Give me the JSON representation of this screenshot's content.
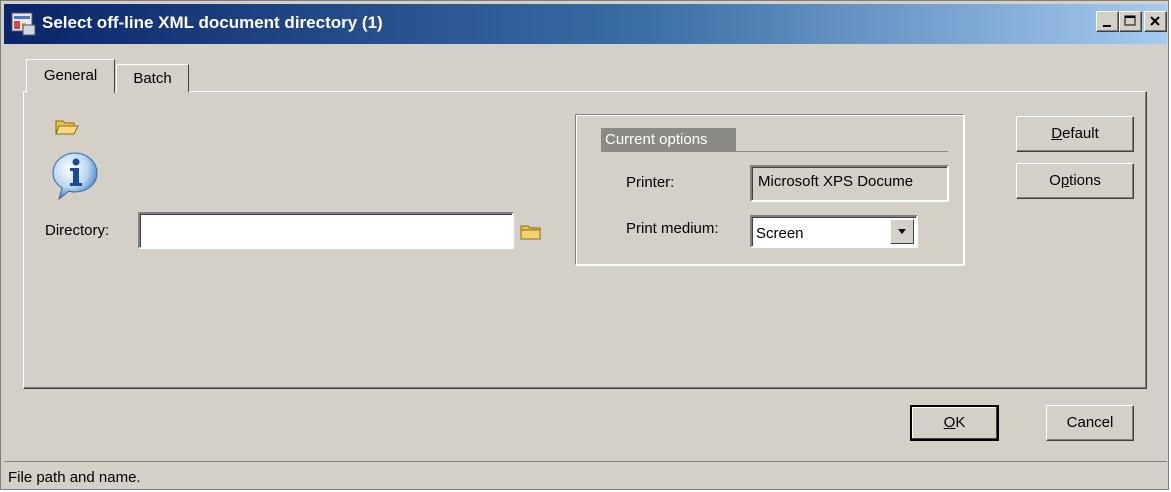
{
  "window": {
    "title": "Select off-line XML document directory (1)",
    "controls": [
      "minimize",
      "maximize",
      "close"
    ]
  },
  "tabs": [
    {
      "label": "General",
      "active": true
    },
    {
      "label": "Batch",
      "active": false
    }
  ],
  "general": {
    "icons": [
      "open-folder-icon",
      "info-icon"
    ],
    "directory_label": "Directory:",
    "directory_value": ""
  },
  "current_options": {
    "title": "Current options",
    "printer_label": "Printer:",
    "printer_value": "Microsoft XPS Docume",
    "print_medium_label": "Print medium:",
    "print_medium_value": "Screen"
  },
  "side_buttons": {
    "default_mnemonic": "D",
    "default_rest": "efault",
    "options_pre": "O",
    "options_mnemonic": "p",
    "options_rest": "tions"
  },
  "footer_buttons": {
    "ok_mnemonic": "O",
    "ok_rest": "K",
    "cancel_label": "Cancel"
  },
  "status_bar": {
    "text": "File path and name."
  }
}
